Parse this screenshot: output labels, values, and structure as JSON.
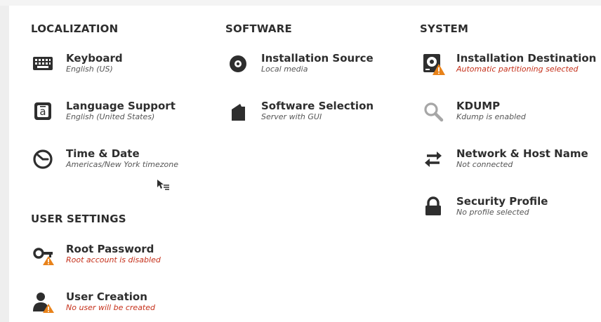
{
  "localization": {
    "heading": "LOCALIZATION",
    "spokes": [
      {
        "title": "Keyboard",
        "status": "English (US)",
        "icon": "keyboard-icon"
      },
      {
        "title": "Language Support",
        "status": "English (United States)",
        "icon": "language-icon"
      },
      {
        "title": "Time & Date",
        "status": "Americas/New York timezone",
        "icon": "clock-icon"
      }
    ]
  },
  "software": {
    "heading": "SOFTWARE",
    "spokes": [
      {
        "title": "Installation Source",
        "status": "Local media",
        "icon": "disc-icon"
      },
      {
        "title": "Software Selection",
        "status": "Server with GUI",
        "icon": "package-icon"
      }
    ]
  },
  "system": {
    "heading": "SYSTEM",
    "spokes": [
      {
        "title": "Installation Destination",
        "status": "Automatic partitioning selected",
        "icon": "disk-warning-icon",
        "warning": true
      },
      {
        "title": "KDUMP",
        "status": "Kdump is enabled",
        "icon": "search-icon"
      },
      {
        "title": "Network & Host Name",
        "status": "Not connected",
        "icon": "network-arrows-icon"
      },
      {
        "title": "Security Profile",
        "status": "No profile selected",
        "icon": "lock-icon"
      }
    ]
  },
  "user_settings": {
    "heading": "USER SETTINGS",
    "spokes": [
      {
        "title": "Root Password",
        "status": "Root account is disabled",
        "icon": "key-warning-icon",
        "warning": true
      },
      {
        "title": "User Creation",
        "status": "No user will be created",
        "icon": "user-warning-icon",
        "warning": true
      }
    ]
  },
  "colors": {
    "text": "#2e2e2e",
    "status": "#555555",
    "warning_text": "#c5301a",
    "warning_badge": "#e8821a"
  }
}
